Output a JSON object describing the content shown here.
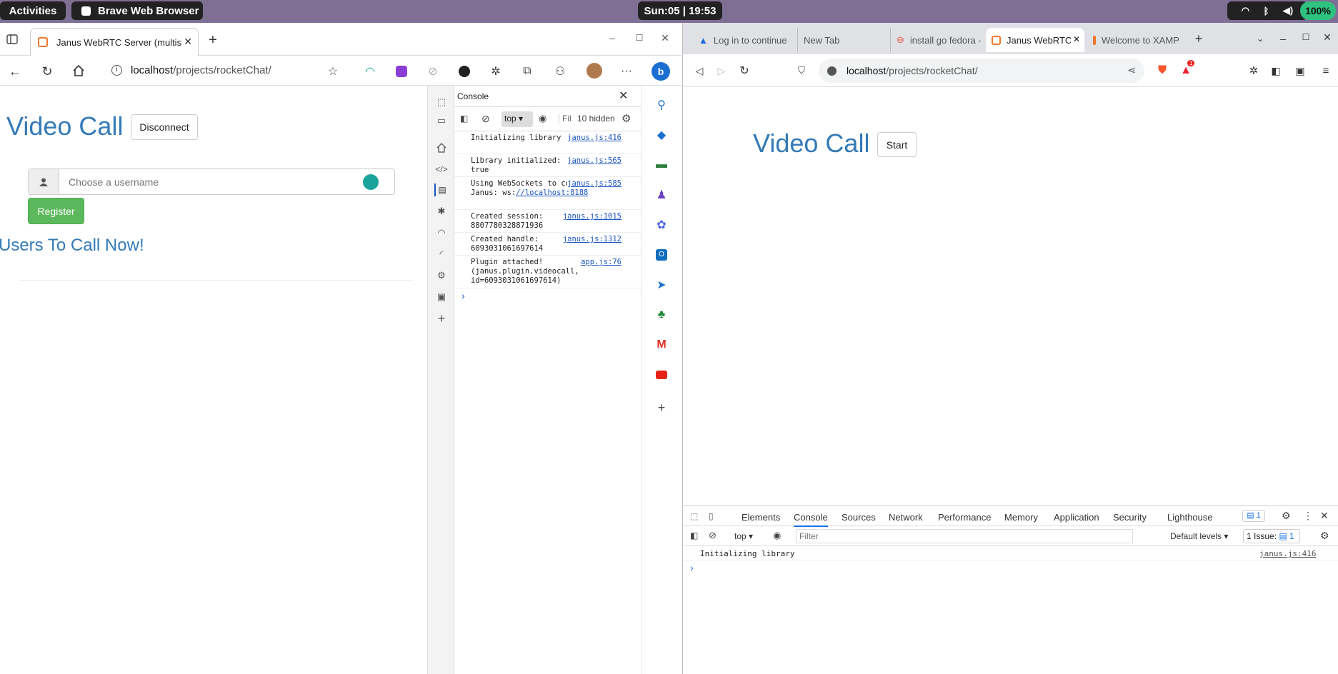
{
  "topbar": {
    "activities": "Activities",
    "app_name": "Brave Web Browser",
    "clock": "Sun:05 | 19:53",
    "battery": "100%"
  },
  "left_window": {
    "tab_title": "Janus WebRTC Server (multist",
    "new_tab": "+",
    "url_host": "localhost",
    "url_path": "/projects/rocketChat/",
    "page": {
      "title": "Video Call",
      "disconnect_button": "Disconnect",
      "username_placeholder": "Choose a username",
      "register_button": "Register",
      "users_heading": "Users To Call Now!"
    },
    "devtools": {
      "header": "Console",
      "context": "top",
      "filter_placeholder": "Fil",
      "hidden_count": "10 hidden",
      "logs": [
        {
          "msg": "Initializing library",
          "src": "janus.js:416"
        },
        {
          "msg": "Library initialized: true",
          "src": "janus.js:565"
        },
        {
          "msg": "Using WebSockets to contact Janus: ws:",
          "link": "//localhost:8188",
          "src": "janus.js:585"
        },
        {
          "msg": "Created session: 8807780328871936",
          "src": "janus.js:1015"
        },
        {
          "msg": "Created handle: 6093031061697614",
          "src": "janus.js:1312"
        },
        {
          "msg": "Plugin attached! (janus.plugin.videocall, id=6093031061697614)",
          "src": "app.js:76"
        }
      ],
      "prompt": "›"
    }
  },
  "right_window": {
    "tabs": [
      {
        "label": "Log in to continue"
      },
      {
        "label": "New Tab"
      },
      {
        "label": "install go fedora -"
      },
      {
        "label": "Janus WebRTC"
      },
      {
        "label": "Welcome to XAMP"
      }
    ],
    "new_tab": "+",
    "url_host": "localhost",
    "url_path": "/projects/rocketChat/",
    "brave_badge": "1",
    "page": {
      "title": "Video Call",
      "start_button": "Start"
    },
    "devtools": {
      "tabs": [
        "Elements",
        "Console",
        "Sources",
        "Network",
        "Performance",
        "Memory",
        "Application",
        "Security",
        "Lighthouse"
      ],
      "issues_badge": "1",
      "context": "top",
      "filter_placeholder": "Filter",
      "levels": "Default levels",
      "issue_text": "1 Issue:",
      "issue_count": "1",
      "log_msg": "Initializing library",
      "log_src": "janus.js:416",
      "prompt": "›"
    }
  },
  "colors": {
    "topbar": "#7f6f94",
    "link_blue": "#337ab7",
    "register_green": "#5cb85c",
    "devtools_link": "#1a55c0"
  }
}
